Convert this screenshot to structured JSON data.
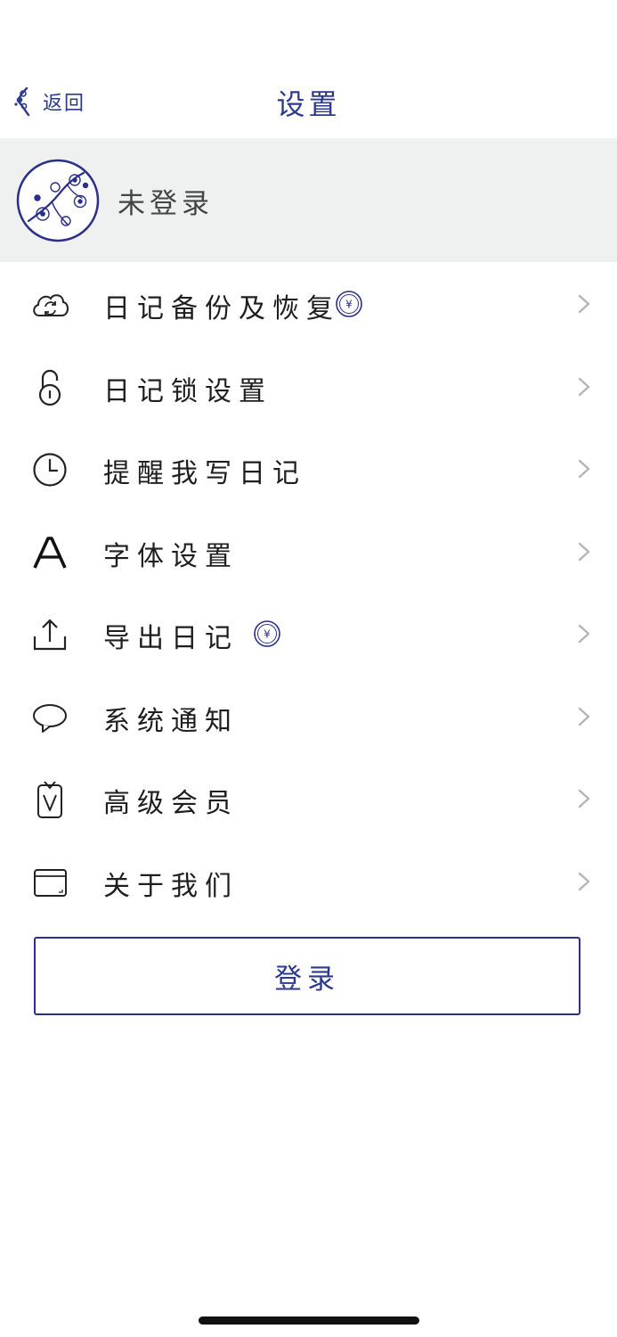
{
  "header": {
    "back_label": "返回",
    "title": "设置"
  },
  "profile": {
    "name": "未登录"
  },
  "menu": [
    {
      "id": "backup",
      "label": "日记备份及恢复",
      "icon": "cloud-sync-icon",
      "badge": "¥"
    },
    {
      "id": "lock",
      "label": "日记锁设置",
      "icon": "unlock-icon"
    },
    {
      "id": "reminder",
      "label": "提醒我写日记",
      "icon": "clock-icon"
    },
    {
      "id": "font",
      "label": "字体设置",
      "icon": "font-icon"
    },
    {
      "id": "export",
      "label": "导出日记",
      "icon": "upload-icon",
      "badge": "¥"
    },
    {
      "id": "notice",
      "label": "系统通知",
      "icon": "chat-bubble-icon"
    },
    {
      "id": "vip",
      "label": "高级会员",
      "icon": "vip-card-icon"
    },
    {
      "id": "about",
      "label": "关于我们",
      "icon": "window-card-icon"
    }
  ],
  "login_button": {
    "label": "登录"
  },
  "colors": {
    "accent": "#2b3a8f",
    "profile_bg": "#eff0f0",
    "chevron": "#b5b5b5"
  }
}
